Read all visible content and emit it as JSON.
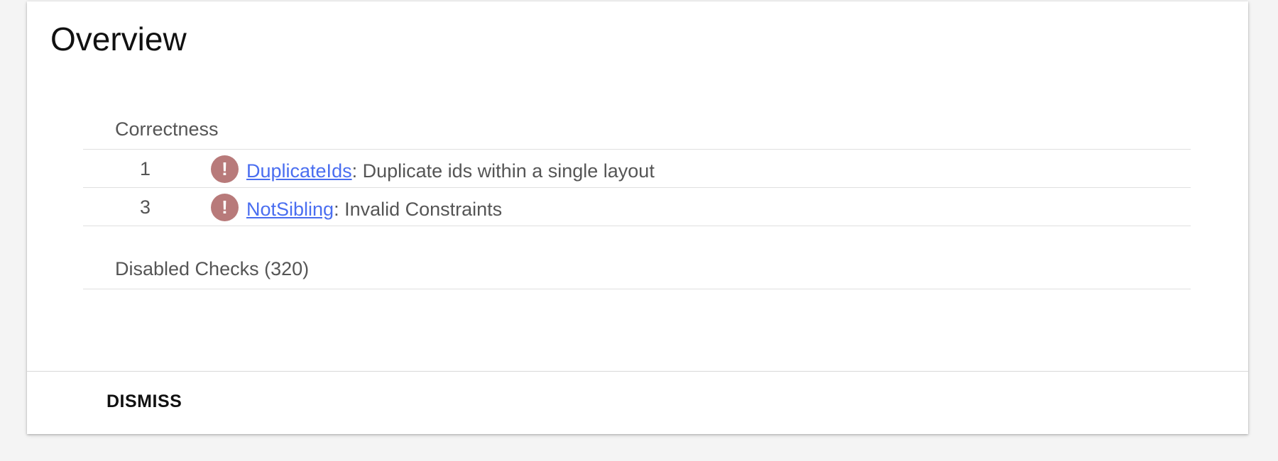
{
  "overview": {
    "title": "Overview"
  },
  "sections": {
    "correctness": {
      "label": "Correctness",
      "issues": [
        {
          "count": "1",
          "icon": "error-icon",
          "icon_glyph": "!",
          "link_text": "DuplicateIds",
          "description": ": Duplicate ids within a single layout"
        },
        {
          "count": "3",
          "icon": "error-icon",
          "icon_glyph": "!",
          "link_text": "NotSibling",
          "description": ": Invalid Constraints"
        }
      ]
    },
    "disabled": {
      "label": "Disabled Checks (320)"
    }
  },
  "footer": {
    "dismiss_label": "DISMISS"
  },
  "colors": {
    "link": "#4a6ef0",
    "error_icon": "#b87a7a",
    "background": "#f4f4f4",
    "card": "#ffffff"
  }
}
